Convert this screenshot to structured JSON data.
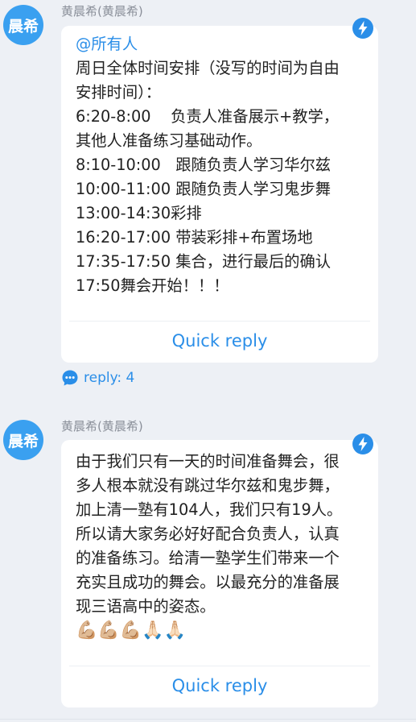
{
  "messages": [
    {
      "avatar_text": "晨希",
      "sender": "黄晨希(黄晨希)",
      "mention": "@所有人",
      "lines": [
        "周日全体时间安排（没写的时间为自由",
        "安排时间）：",
        "6:20-8:00    负责人准备展示+教学，",
        "其他人准备练习基础动作。",
        "8:10-10:00   跟随负责人学习华尔兹",
        "10:00-11:00 跟随负责人学习鬼步舞",
        "13:00-14:30彩排",
        "16:20-17:00 带装彩排+布置场地",
        "17:35-17:50 集合，进行最后的确认",
        "17:50舞会开始！！！"
      ],
      "quick_reply": "Quick reply",
      "reply_count_label": "reply: 4",
      "bolt_icon": "lightning-bolt-icon"
    },
    {
      "avatar_text": "晨希",
      "sender": "黄晨希(黄晨希)",
      "lines": [
        "由于我们只有一天的时间准备舞会，很",
        "多人根本就没有跳过华尔兹和鬼步舞，",
        "加上清一塾有104人，我们只有19人。",
        "所以请大家务必好好配合负责人，认真",
        "的准备练习。给清一塾学生们带来一个",
        "充实且成功的舞会。以最充分的准备展",
        "现三语高中的姿态。"
      ],
      "emojis": "💪🏼💪🏼💪🏼🙏🏻🙏🏻",
      "quick_reply": "Quick reply",
      "bolt_icon": "lightning-bolt-icon"
    }
  ],
  "colors": {
    "background": "#edf0f5",
    "accent": "#2a8ee8",
    "avatar": "#3aa0f0"
  }
}
